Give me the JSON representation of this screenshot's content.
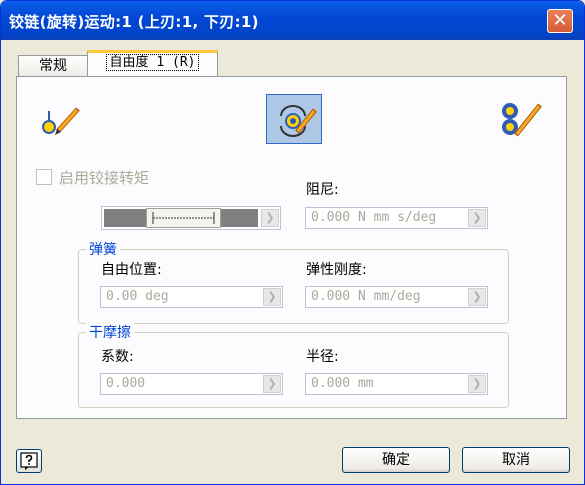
{
  "window": {
    "title": "铰链(旋转)运动:1 (上刃:1, 下刃:1)",
    "close_glyph": "✕"
  },
  "tabs": [
    {
      "label": "常规"
    },
    {
      "label": "自由度 1 (R)"
    }
  ],
  "dof_buttons": [
    {
      "icon": "initial-position-pencil-icon"
    },
    {
      "icon": "joint-rotation-pencil-icon"
    },
    {
      "icon": "dof-link-pencil-icon"
    }
  ],
  "torque": {
    "checkbox_label": "启用铰接转矩",
    "checked": false
  },
  "damping": {
    "label": "阻尼:",
    "value": "0.000 N mm s/deg"
  },
  "spring": {
    "group_title": "弹簧",
    "free_position": {
      "label": "自由位置:",
      "value": "0.00 deg"
    },
    "stiffness": {
      "label": "弹性刚度:",
      "value": "0.000 N mm/deg"
    }
  },
  "friction": {
    "group_title": "干摩擦",
    "coefficient": {
      "label": "系数:",
      "value": "0.000"
    },
    "radius": {
      "label": "半径:",
      "value": "0.000 mm"
    }
  },
  "footer": {
    "ok_label": "确定",
    "cancel_label": "取消"
  },
  "arrow_glyph": "❯",
  "colors": {
    "title_bar": "#0348D6",
    "group_title": "#0046D5",
    "disabled_text": "#ACA899",
    "close_button": "#D65B32"
  }
}
